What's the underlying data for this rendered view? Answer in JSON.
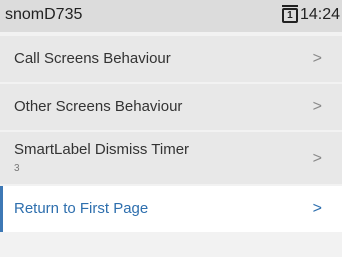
{
  "status": {
    "device_name": "snomD735",
    "line_number": "1",
    "time": "14:24"
  },
  "menu": {
    "items": [
      {
        "label": "Call Screens Behaviour",
        "chevron": ">"
      },
      {
        "label": "Other Screens Behaviour",
        "chevron": ">"
      },
      {
        "label": "SmartLabel Dismiss Timer",
        "value": "3",
        "chevron": ">"
      },
      {
        "label": "Return to First Page",
        "chevron": ">"
      }
    ],
    "selected_index": 3
  },
  "colors": {
    "accent": "#2e6fae",
    "statusbar_bg": "#dcdcdc",
    "item_bg": "#e8e8e8"
  }
}
